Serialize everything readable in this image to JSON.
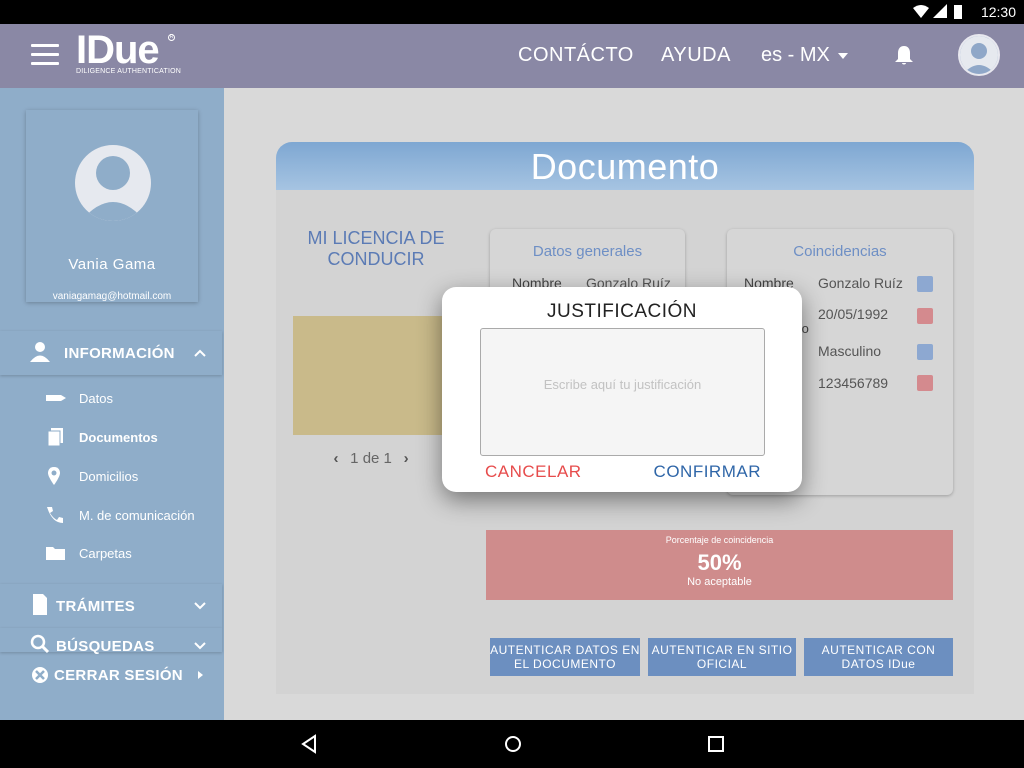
{
  "status_bar": {
    "time": "12:30"
  },
  "header": {
    "logo_text": "IDue",
    "logo_subtitle": "DILIGENCE AUTHENTICATION",
    "nav": [
      {
        "label": "CONTÁCTO"
      },
      {
        "label": "AYUDA"
      }
    ],
    "language": "es - MX"
  },
  "sidebar": {
    "profile": {
      "name": "Vania Gama",
      "email": "vaniagamag@hotmail.com"
    },
    "sections": [
      {
        "label": "INFORMACIÓN",
        "icon": "person-icon",
        "expanded": true
      },
      {
        "label": "TRÁMITES",
        "icon": "document-icon",
        "expanded": false
      },
      {
        "label": "BÚSQUEDAS",
        "icon": "search-icon",
        "expanded": false
      },
      {
        "label": "CERRAR SESIÓN",
        "icon": "close-circle-icon",
        "expanded": false
      }
    ],
    "items": [
      {
        "label": "Datos",
        "icon": "tag-icon",
        "active": false
      },
      {
        "label": "Documentos",
        "icon": "documents-icon",
        "active": true
      },
      {
        "label": "Domicilios",
        "icon": "location-pin-icon",
        "active": false
      },
      {
        "label": "M. de comunicación",
        "icon": "phone-icon",
        "active": false
      },
      {
        "label": "Carpetas",
        "icon": "folder-icon",
        "active": false
      }
    ]
  },
  "main": {
    "title": "Documento",
    "document_title": "MI LICENCIA DE CONDUCIR",
    "pager": {
      "current": "1",
      "separator": "de",
      "total": "1"
    },
    "general_data": {
      "title": "Datos generales",
      "rows": [
        {
          "label": "Nombre",
          "value": "Gonzalo Ruíz"
        }
      ]
    },
    "matches": {
      "title": "Coincidencias",
      "rows": [
        {
          "label": "Nombre",
          "value": "Gonzalo Ruíz",
          "status": "ok"
        },
        {
          "label": "to",
          "value": "20/05/1992",
          "status": "bad"
        },
        {
          "label": "",
          "value": "Masculino",
          "status": "ok"
        },
        {
          "label": "",
          "value": "123456789",
          "status": "bad"
        }
      ]
    },
    "score": {
      "label": "Porcentaje de coincidencia",
      "value": "50%",
      "status": "No aceptable"
    },
    "buttons": [
      {
        "label": "AUTENTICAR DATOS EN EL DOCUMENTO"
      },
      {
        "label": "AUTENTICAR EN SITIO OFICIAL"
      },
      {
        "label": "AUTENTICAR CON DATOS IDue"
      }
    ]
  },
  "dialog": {
    "title": "JUSTIFICACIÓN",
    "placeholder": "Escribe aquí tu justificación",
    "cancel": "CANCELAR",
    "confirm": "CONFIRMAR"
  },
  "colors": {
    "header": "#8a88a5",
    "sidebar": "#8fadc9",
    "cancel": "#e74c4c",
    "confirm": "#2f66a8",
    "score_bad": "#cf8c8c"
  }
}
